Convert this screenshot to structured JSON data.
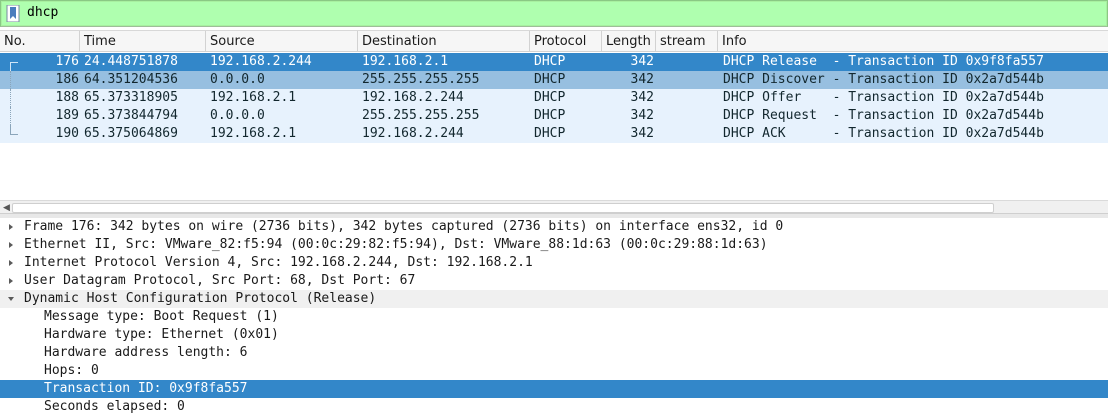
{
  "filter": {
    "value": "dhcp"
  },
  "packet_list": {
    "columns": [
      "No.",
      "Time",
      "Source",
      "Destination",
      "Protocol",
      "Length",
      "stream",
      "Info"
    ],
    "rows": [
      {
        "no": "176",
        "time": "24.448751878",
        "source": "192.168.2.244",
        "destination": "192.168.2.1",
        "protocol": "DHCP",
        "length": "342",
        "stream": "",
        "info": "DHCP Release  - Transaction ID 0x9f8fa557",
        "state": "selected"
      },
      {
        "no": "186",
        "time": "64.351204536",
        "source": "0.0.0.0",
        "destination": "255.255.255.255",
        "protocol": "DHCP",
        "length": "342",
        "stream": "",
        "info": "DHCP Discover - Transaction ID 0x2a7d544b",
        "state": "related"
      },
      {
        "no": "188",
        "time": "65.373318905",
        "source": "192.168.2.1",
        "destination": "192.168.2.244",
        "protocol": "DHCP",
        "length": "342",
        "stream": "",
        "info": "DHCP Offer    - Transaction ID 0x2a7d544b",
        "state": "normal"
      },
      {
        "no": "189",
        "time": "65.373844794",
        "source": "0.0.0.0",
        "destination": "255.255.255.255",
        "protocol": "DHCP",
        "length": "342",
        "stream": "",
        "info": "DHCP Request  - Transaction ID 0x2a7d544b",
        "state": "normal"
      },
      {
        "no": "190",
        "time": "65.375064869",
        "source": "192.168.2.1",
        "destination": "192.168.2.244",
        "protocol": "DHCP",
        "length": "342",
        "stream": "",
        "info": "DHCP ACK      - Transaction ID 0x2a7d544b",
        "state": "normal"
      }
    ]
  },
  "details": {
    "rows": [
      {
        "text": "Frame 176: 342 bytes on wire (2736 bits), 342 bytes captured (2736 bits) on interface ens32, id 0",
        "level": 0,
        "expander": "collapsed",
        "state": "normal"
      },
      {
        "text": "Ethernet II, Src: VMware_82:f5:94 (00:0c:29:82:f5:94), Dst: VMware_88:1d:63 (00:0c:29:88:1d:63)",
        "level": 0,
        "expander": "collapsed",
        "state": "normal"
      },
      {
        "text": "Internet Protocol Version 4, Src: 192.168.2.244, Dst: 192.168.2.1",
        "level": 0,
        "expander": "collapsed",
        "state": "normal"
      },
      {
        "text": "User Datagram Protocol, Src Port: 68, Dst Port: 67",
        "level": 0,
        "expander": "collapsed",
        "state": "normal"
      },
      {
        "text": "Dynamic Host Configuration Protocol (Release)",
        "level": 0,
        "expander": "expanded",
        "state": "alt"
      },
      {
        "text": "Message type: Boot Request (1)",
        "level": 1,
        "expander": "none",
        "state": "normal"
      },
      {
        "text": "Hardware type: Ethernet (0x01)",
        "level": 1,
        "expander": "none",
        "state": "normal"
      },
      {
        "text": "Hardware address length: 6",
        "level": 1,
        "expander": "none",
        "state": "normal"
      },
      {
        "text": "Hops: 0",
        "level": 1,
        "expander": "none",
        "state": "normal"
      },
      {
        "text": "Transaction ID: 0x9f8fa557",
        "level": 1,
        "expander": "none",
        "state": "selected"
      },
      {
        "text": "Seconds elapsed: 0",
        "level": 1,
        "expander": "none",
        "state": "normal"
      }
    ]
  },
  "colors": {
    "filter_valid_bg": "#afffaf",
    "row_bg": "#e7f2fd",
    "row_selected": "#3387c9",
    "row_related": "#97bfe0"
  }
}
